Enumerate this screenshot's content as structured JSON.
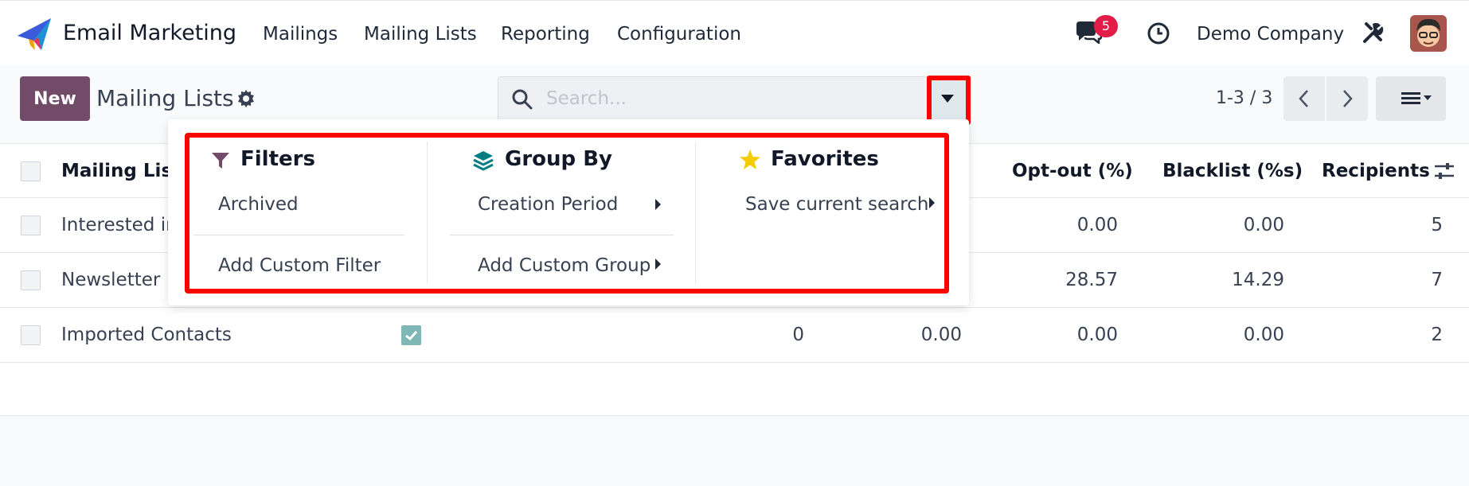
{
  "navbar": {
    "app_title": "Email Marketing",
    "menus": [
      "Mailings",
      "Mailing Lists",
      "Reporting",
      "Configuration"
    ],
    "notification_count": "5",
    "company": "Demo Company",
    "icons": [
      "paper-plane-logo",
      "chat-icon",
      "clock-icon",
      "tools-icon",
      "avatar"
    ]
  },
  "control": {
    "new_label": "New",
    "title": "Mailing Lists",
    "search_placeholder": "Search...",
    "pager": "1-3 / 3"
  },
  "dropdown": {
    "filters": {
      "title": "Filters",
      "items": [
        "Archived"
      ],
      "custom": "Add Custom Filter"
    },
    "group_by": {
      "title": "Group By",
      "items": [
        "Creation Period"
      ],
      "custom": "Add Custom Group"
    },
    "favorites": {
      "title": "Favorites",
      "items": [
        "Save current search"
      ]
    }
  },
  "table": {
    "columns": [
      "Mailing List",
      "Opt-out (%)",
      "Blacklist (%s)",
      "Recipients"
    ],
    "rows": [
      {
        "name": "Interested in",
        "col_a": "",
        "col_b": "",
        "optout": "0.00",
        "blacklist": "0.00",
        "recipients": "5",
        "public": false
      },
      {
        "name": "Newsletter",
        "col_a": "",
        "col_b": "",
        "optout": "28.57",
        "blacklist": "14.29",
        "recipients": "7",
        "public": false
      },
      {
        "name": "Imported Contacts",
        "col_a": "0",
        "col_b": "0.00",
        "optout": "0.00",
        "blacklist": "0.00",
        "recipients": "2",
        "public": true
      }
    ]
  },
  "colors": {
    "primary": "#714b67",
    "highlight": "#ff0000",
    "badge": "#e11d48",
    "checkbox_checked": "#7fb7b6",
    "filter_icon": "#714b67",
    "group_icon": "#017e84",
    "favorite_icon": "#f3cc00"
  }
}
